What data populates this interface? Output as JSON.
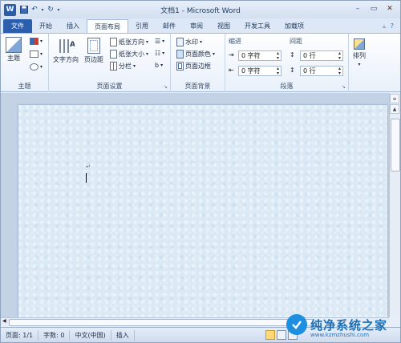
{
  "window": {
    "title": "文档1 - Microsoft Word"
  },
  "quick_access": {
    "logo": "W",
    "save": "save-icon",
    "undo": "undo-icon",
    "redo": "redo-icon"
  },
  "tabs": [
    {
      "label": "文件"
    },
    {
      "label": "开始"
    },
    {
      "label": "插入"
    },
    {
      "label": "页面布局"
    },
    {
      "label": "引用"
    },
    {
      "label": "邮件"
    },
    {
      "label": "审阅"
    },
    {
      "label": "视图"
    },
    {
      "label": "开发工具"
    },
    {
      "label": "加载项"
    }
  ],
  "ribbon": {
    "theme": {
      "label": "主题",
      "button": "主题"
    },
    "page_setup": {
      "label": "页面设置",
      "text_direction": "文字方向",
      "margins": "页边距",
      "orientation": "纸张方向",
      "size": "纸张大小",
      "columns": "分栏"
    },
    "page_background": {
      "label": "页面背景",
      "watermark": "水印",
      "page_color": "页面颜色",
      "page_border": "页面边框"
    },
    "paragraph": {
      "label": "段落",
      "indent": "缩进",
      "spacing": "间距",
      "indent_left": "0 字符",
      "indent_right": "0 字符",
      "spacing_before": "0 行",
      "spacing_after": "0 行"
    },
    "arrange": {
      "label": "排列"
    }
  },
  "document": {
    "paragraph_mark": "↵"
  },
  "statusbar": {
    "page": "页面: 1/1",
    "words": "字数: 0",
    "language": "中文(中国)",
    "mode": "插入"
  },
  "watermark": {
    "text": "纯净系统之家",
    "url": "www.kzmzhushi.com"
  }
}
